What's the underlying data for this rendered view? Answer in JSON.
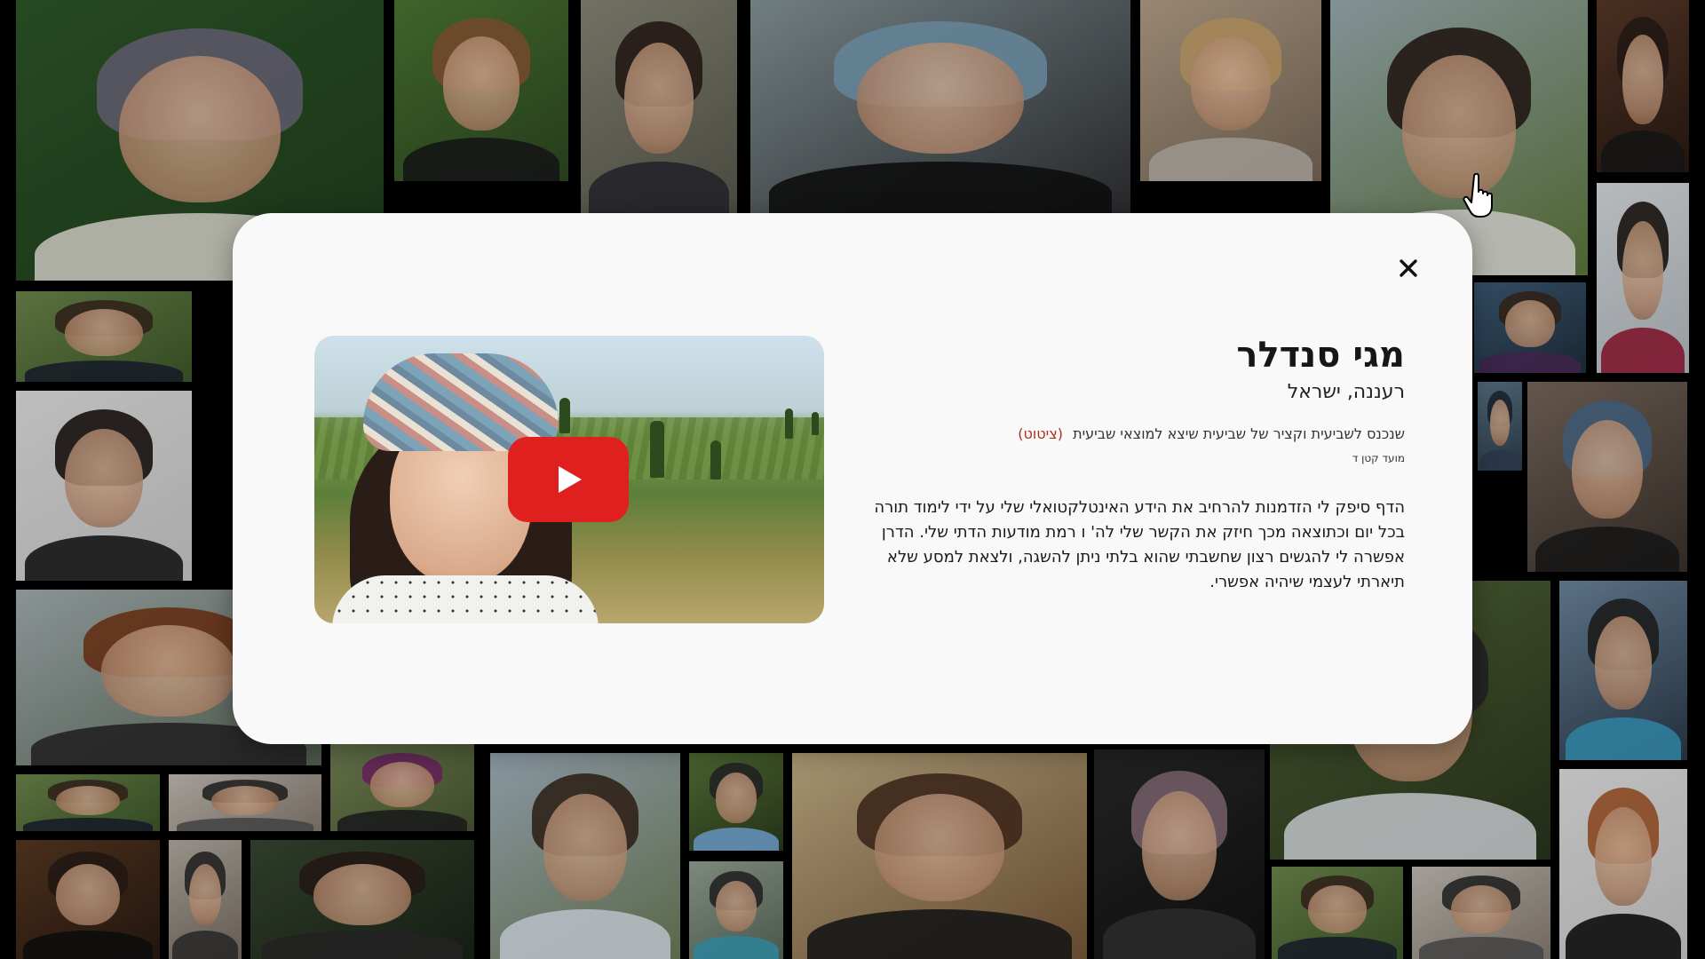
{
  "modal": {
    "close_label": "×",
    "name": "מגי סנדלר",
    "location": "רעננה, ישראל",
    "quote_text": "שנכנס לשביעית וקציר של שביעית שיצא למוצאי שביעית",
    "quote_link": "(ציטוט)",
    "cycle": "מועד קטן ד",
    "body": "הדף סיפק לי הזדמנות להרחיב את הידע האינטלקטואלי שלי על ידי לימוד תורה בכל יום וכתוצאה מכך חיזק את הקשר שלי לה' ו רמת מודעות הדתי שלי. הדרן אפשרה לי להגשים רצון שחשבתי שהוא בלתי ניתן להשגה, ולצאת למסע שלא תיארתי לעצמי שיהיה אפשרי."
  },
  "video": {
    "play_icon": "play-icon"
  },
  "colors": {
    "modal_bg": "#f9f9f9",
    "play_button": "#e01f1f",
    "cite_link": "#b02b1c"
  }
}
